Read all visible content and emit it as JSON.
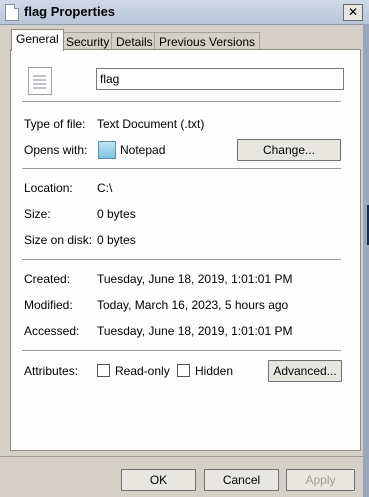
{
  "window": {
    "title": "flag Properties",
    "close_glyph": "✕"
  },
  "tabs": [
    "General",
    "Security",
    "Details",
    "Previous Versions"
  ],
  "general": {
    "filename": "flag",
    "type_label": "Type of file:",
    "type_value": "Text Document (.txt)",
    "opens_label": "Opens with:",
    "opens_value": "Notepad",
    "change_button": "Change...",
    "location_label": "Location:",
    "location_value": "C:\\",
    "size_label": "Size:",
    "size_value": "0 bytes",
    "size_on_disk_label": "Size on disk:",
    "size_on_disk_value": "0 bytes",
    "created_label": "Created:",
    "created_value": "Tuesday, June 18, 2019, 1:01:01 PM",
    "modified_label": "Modified:",
    "modified_value": "Today, March 16, 2023, 5 hours ago",
    "accessed_label": "Accessed:",
    "accessed_value": "Tuesday, June 18, 2019, 1:01:01 PM",
    "attributes_label": "Attributes:",
    "readonly_label": "Read-only",
    "hidden_label": "Hidden",
    "advanced_button": "Advanced..."
  },
  "footer": {
    "ok": "OK",
    "cancel": "Cancel",
    "apply": "Apply"
  }
}
